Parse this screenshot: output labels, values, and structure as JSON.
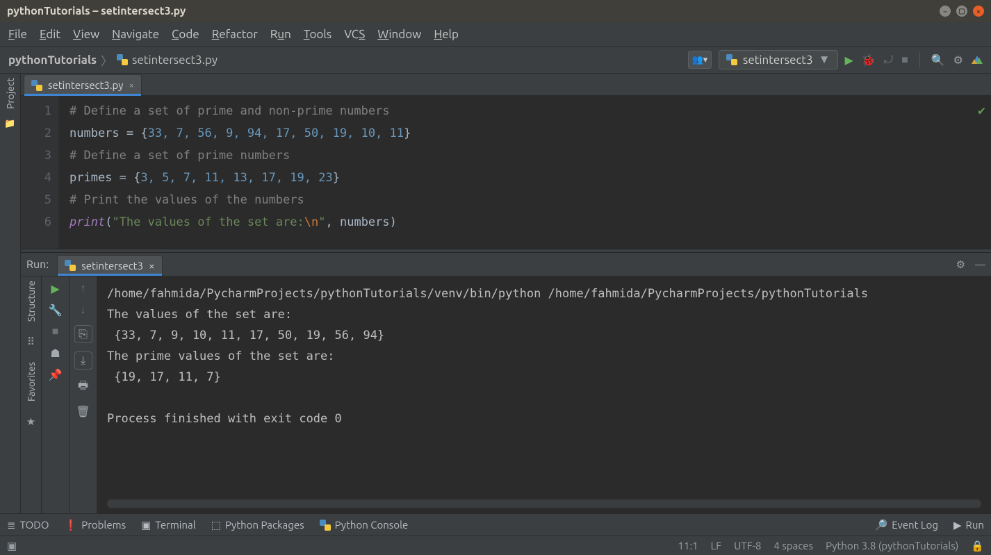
{
  "titlebar": {
    "text": "pythonTutorials – setintersect3.py"
  },
  "menu": [
    "File",
    "Edit",
    "View",
    "Navigate",
    "Code",
    "Refactor",
    "Run",
    "Tools",
    "VCS",
    "Window",
    "Help"
  ],
  "breadcrumb": {
    "project": "pythonTutorials",
    "file": "setintersect3.py"
  },
  "runConfig": {
    "label": "setintersect3"
  },
  "editorTab": {
    "label": "setintersect3.py"
  },
  "editor": {
    "lines": [
      "1",
      "2",
      "3",
      "4",
      "5",
      "6"
    ],
    "l1": "# Define a set of prime and non-prime numbers",
    "l2a": "numbers = {",
    "l2nums": "33, 7, 56, 9, 94, 17, 50, 19, 10, 11",
    "l2b": "}",
    "l3": "# Define a set of prime numbers",
    "l4a": "primes = {",
    "l4nums": "3, 5, 7, 11, 13, 17, 19, 23",
    "l4b": "}",
    "l5": "# Print the values of the numbers",
    "l6fn": "print",
    "l6p1": "(",
    "l6str1": "\"The values of the set are:",
    "l6esc": "\\n",
    "l6str2": "\"",
    "l6mid": ", numbers)",
    "dummy": ""
  },
  "runPanel": {
    "title": "Run:",
    "tab": "setintersect3",
    "out1": "/home/fahmida/PycharmProjects/pythonTutorials/venv/bin/python /home/fahmida/PycharmProjects/pythonTutorials",
    "out2": "The values of the set are:",
    "out3": " {33, 7, 9, 10, 11, 17, 50, 19, 56, 94}",
    "out4": "The prime values of the set are:",
    "out5": " {19, 17, 11, 7}",
    "out6": "",
    "out7": "Process finished with exit code 0"
  },
  "leftTools": {
    "project": "Project",
    "structure": "Structure",
    "favorites": "Favorites"
  },
  "toolstrip": {
    "todo": "TODO",
    "problems": "Problems",
    "terminal": "Terminal",
    "pypkg": "Python Packages",
    "pyconsole": "Python Console",
    "eventlog": "Event Log",
    "run": "Run"
  },
  "status": {
    "pos": "11:1",
    "le": "LF",
    "enc": "UTF-8",
    "indent": "4 spaces",
    "interp": "Python 3.8 (pythonTutorials)"
  }
}
